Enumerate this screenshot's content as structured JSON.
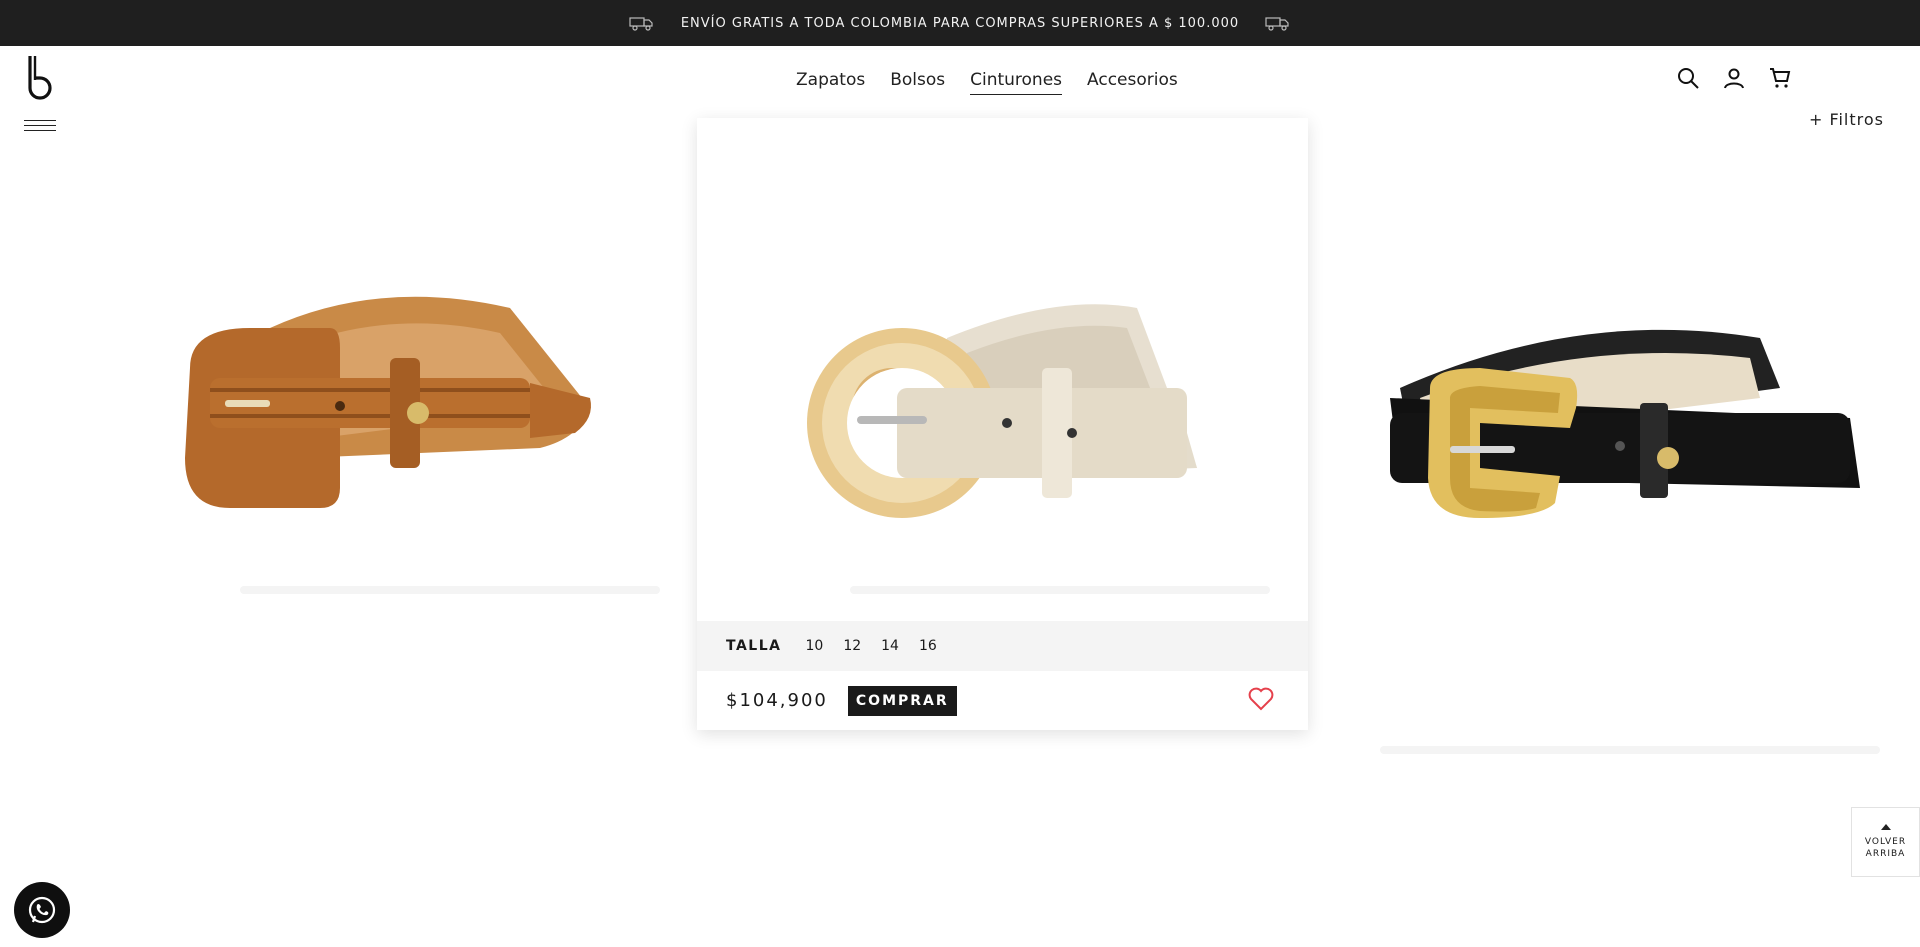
{
  "promo": {
    "text": "ENVÍO GRATIS A TODA COLOMBIA PARA COMPRAS SUPERIORES A $ 100.000"
  },
  "header": {
    "nav": [
      {
        "label": "Zapatos",
        "active": false
      },
      {
        "label": "Bolsos",
        "active": false
      },
      {
        "label": "Cinturones",
        "active": true
      },
      {
        "label": "Accesorios",
        "active": false
      }
    ],
    "icons": [
      "search-icon",
      "user-icon",
      "cart-icon"
    ]
  },
  "filters": {
    "label": "+ Filtros"
  },
  "products": [
    {
      "color": "#b56b2a",
      "buckle": "self",
      "name_visible": false
    },
    {
      "color": "#e7dfd0",
      "buckle": "tortoiseshell",
      "name_visible": false
    },
    {
      "color": "#151515",
      "buckle": "gold",
      "name_visible": false
    }
  ],
  "card": {
    "size_label": "TALLA",
    "sizes": [
      "10",
      "12",
      "14",
      "16"
    ],
    "price": "$104,900",
    "buy_label": "COMPRAR"
  },
  "back_to_top": {
    "line1": "VOLVER",
    "line2": "ARRIBA"
  },
  "colors": {
    "promo_bg": "#1f1f1f",
    "accent_heart": "#e5404b",
    "button_bg": "#1a1a1a"
  }
}
